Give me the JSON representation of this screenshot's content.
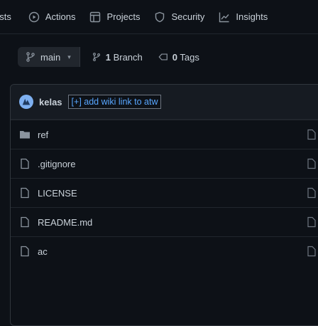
{
  "nav": {
    "tabs": [
      {
        "label": "ests",
        "icon": "clipped-tab"
      },
      {
        "label": "Actions",
        "icon": "play-icon"
      },
      {
        "label": "Projects",
        "icon": "table-icon"
      },
      {
        "label": "Security",
        "icon": "shield-icon"
      },
      {
        "label": "Insights",
        "icon": "graph-icon"
      }
    ]
  },
  "branch": {
    "current": "main",
    "branches_count": "1",
    "branches_label": "Branch",
    "tags_count": "0",
    "tags_label": "Tags"
  },
  "commit": {
    "author": "kelas",
    "wiki_link": "[+] add wiki link to atw"
  },
  "files": [
    {
      "name": "ref",
      "type": "folder"
    },
    {
      "name": ".gitignore",
      "type": "file"
    },
    {
      "name": "LICENSE",
      "type": "file"
    },
    {
      "name": "README.md",
      "type": "file"
    },
    {
      "name": "ac",
      "type": "file"
    }
  ]
}
